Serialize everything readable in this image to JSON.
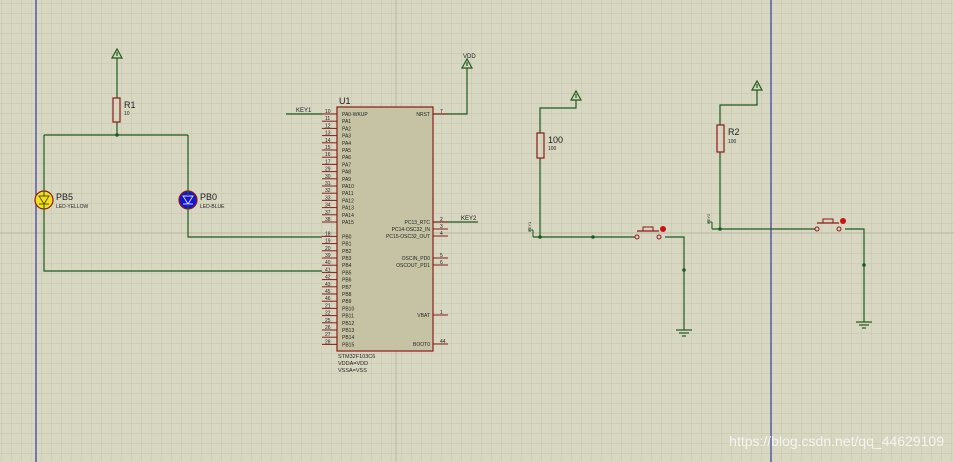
{
  "chip": {
    "ref": "U1",
    "part": "STM32F103C6",
    "vdda": "VDDA=VDD",
    "vssa": "VSSA=VSS",
    "left_pins": [
      {
        "num": "10",
        "name": "PA0-WKUP"
      },
      {
        "num": "11",
        "name": "PA1"
      },
      {
        "num": "12",
        "name": "PA2"
      },
      {
        "num": "13",
        "name": "PA3"
      },
      {
        "num": "14",
        "name": "PA4"
      },
      {
        "num": "15",
        "name": "PA5"
      },
      {
        "num": "16",
        "name": "PA6"
      },
      {
        "num": "17",
        "name": "PA7"
      },
      {
        "num": "29",
        "name": "PA8"
      },
      {
        "num": "30",
        "name": "PA9"
      },
      {
        "num": "31",
        "name": "PA10"
      },
      {
        "num": "32",
        "name": "PA11"
      },
      {
        "num": "33",
        "name": "PA12"
      },
      {
        "num": "34",
        "name": "PA13"
      },
      {
        "num": "37",
        "name": "PA14"
      },
      {
        "num": "38",
        "name": "PA15"
      },
      {
        "num": "18",
        "name": "PB0"
      },
      {
        "num": "19",
        "name": "PB1"
      },
      {
        "num": "20",
        "name": "PB2"
      },
      {
        "num": "39",
        "name": "PB3"
      },
      {
        "num": "40",
        "name": "PB4"
      },
      {
        "num": "41",
        "name": "PB5"
      },
      {
        "num": "42",
        "name": "PB6"
      },
      {
        "num": "43",
        "name": "PB7"
      },
      {
        "num": "45",
        "name": "PB8"
      },
      {
        "num": "46",
        "name": "PB9"
      },
      {
        "num": "21",
        "name": "PB10"
      },
      {
        "num": "22",
        "name": "PB11"
      },
      {
        "num": "25",
        "name": "PB12"
      },
      {
        "num": "26",
        "name": "PB13"
      },
      {
        "num": "27",
        "name": "PB14"
      },
      {
        "num": "28",
        "name": "PB15"
      }
    ],
    "right_pins": [
      {
        "num": "7",
        "name": "NRST"
      },
      {
        "num": "2",
        "name": "PC13_RTC"
      },
      {
        "num": "3",
        "name": "PC14-OSC32_IN"
      },
      {
        "num": "4",
        "name": "PC15-OSC32_OUT"
      },
      {
        "num": "5",
        "name": "OSCIN_PD0"
      },
      {
        "num": "6",
        "name": "OSCOUT_PD1"
      },
      {
        "num": "1",
        "name": "VBAT"
      },
      {
        "num": "44",
        "name": "BOOT0"
      }
    ]
  },
  "labels": {
    "key1": "KEY1",
    "key2": "KEY2",
    "vdd": "VDD",
    "r1_ref": "R1",
    "r1_val": "10",
    "r2_ref": "R2",
    "r2_val": "100",
    "r3_ref": "100",
    "r3_val": "100",
    "pb5_ref": "PB5",
    "pb5_type": "LED-YELLOW",
    "pb0_ref": "PB0",
    "pb0_type": "LED-BLUE",
    "k1_tag": "KEY1",
    "k2_tag": "KEY2"
  },
  "watermark": "https://blog.csdn.net/qq_44629109",
  "colors": {
    "background": "#d7d7c2",
    "grid": "#c4c4ae",
    "wire": "#1f5a1f",
    "part_outline": "#8b1a1a",
    "chip_fill": "#c5c3a4",
    "text": "#1f1f1f",
    "guide": "#1a1aa0",
    "led_yellow": "#f2e020",
    "led_blue": "#1515d0",
    "button_dot": "#cc1111"
  }
}
